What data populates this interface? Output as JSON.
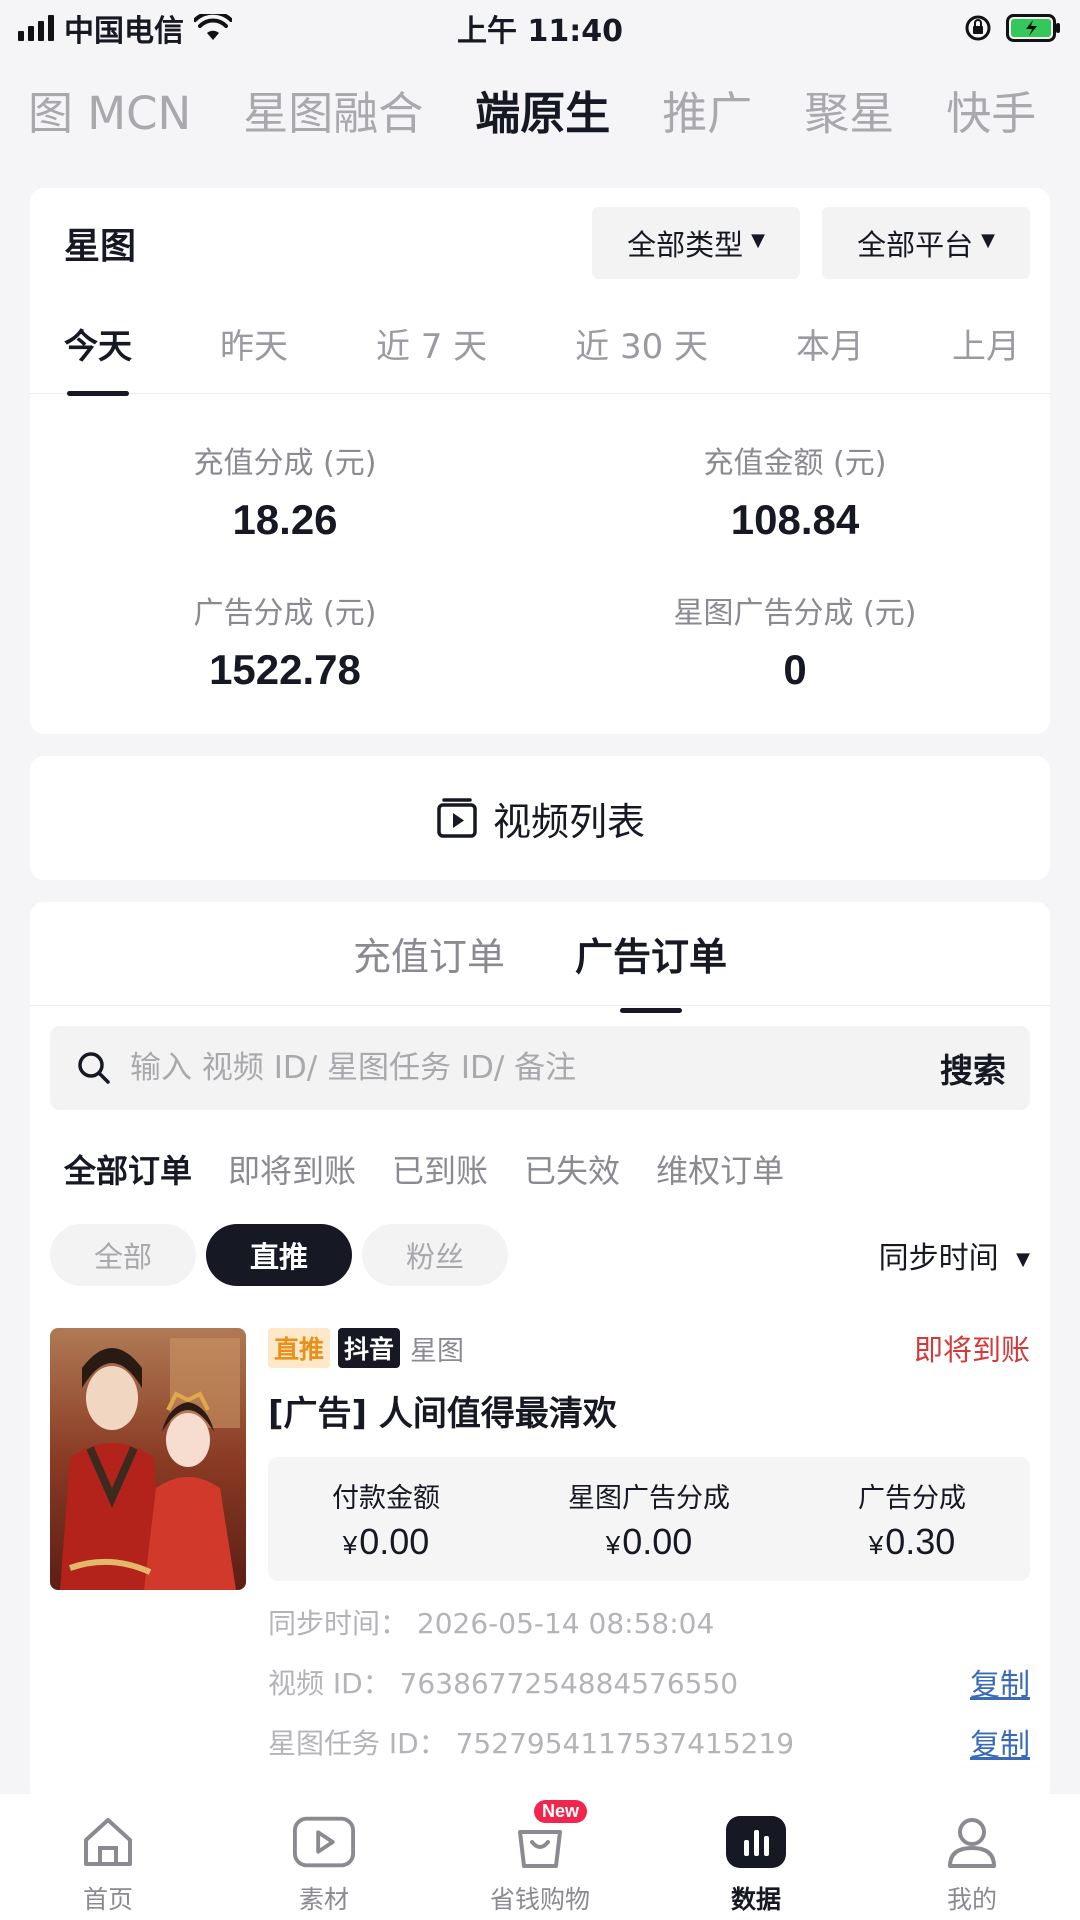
{
  "status_bar": {
    "carrier": "中国电信",
    "time": "上午 11:40"
  },
  "top_tabs": [
    {
      "label": "图 MCN",
      "active": false
    },
    {
      "label": "星图融合",
      "active": false
    },
    {
      "label": "端原生",
      "active": true
    },
    {
      "label": "推广",
      "active": false
    },
    {
      "label": "聚星",
      "active": false
    },
    {
      "label": "快手",
      "active": false
    }
  ],
  "stats_card": {
    "title": "星图",
    "filter_type": "全部类型",
    "filter_platform": "全部平台",
    "date_tabs": [
      {
        "label": "今天",
        "active": true
      },
      {
        "label": "昨天",
        "active": false
      },
      {
        "label": "近 7 天",
        "active": false
      },
      {
        "label": "近 30 天",
        "active": false
      },
      {
        "label": "本月",
        "active": false
      },
      {
        "label": "上月",
        "active": false
      }
    ],
    "stats": [
      {
        "label": "充值分成 (元)",
        "value": "18.26"
      },
      {
        "label": "充值金额 (元)",
        "value": "108.84"
      },
      {
        "label": "广告分成 (元)",
        "value": "1522.78"
      },
      {
        "label": "星图广告分成 (元)",
        "value": "0"
      }
    ]
  },
  "video_list": {
    "label": "视频列表",
    "icon": "video-list-icon"
  },
  "orders": {
    "type_tabs": [
      {
        "label": "充值订单",
        "active": false
      },
      {
        "label": "广告订单",
        "active": true
      }
    ],
    "search": {
      "placeholder": "输入 视频 ID/ 星图任务 ID/ 备注",
      "value": "",
      "button": "搜索"
    },
    "status_tabs": [
      {
        "label": "全部订单",
        "active": true
      },
      {
        "label": "即将到账",
        "active": false
      },
      {
        "label": "已到账",
        "active": false
      },
      {
        "label": "已失效",
        "active": false
      },
      {
        "label": "维权订单",
        "active": false
      }
    ],
    "chips": [
      {
        "label": "全部",
        "active": false
      },
      {
        "label": "直推",
        "active": true
      },
      {
        "label": "粉丝",
        "active": false
      }
    ],
    "sort_label": "同步时间",
    "items": [
      {
        "tag_direct": "直推",
        "tag_platform": "抖音",
        "tag_source": "星图",
        "status": "即将到账",
        "title": "[广告] 人间值得最清欢",
        "amounts": [
          {
            "label": "付款金额",
            "currency": "¥",
            "value": "0.00"
          },
          {
            "label": "星图广告分成",
            "currency": "¥",
            "value": "0.00"
          },
          {
            "label": "广告分成",
            "currency": "¥",
            "value": "0.30"
          }
        ],
        "sync_time": "同步时间： 2026-05-14 08:58:04",
        "video_id": "视频 ID： 7638677254884576550",
        "task_id": "星图任务 ID： 7527954117537415219",
        "copy_label": "复制"
      }
    ]
  },
  "bottom_nav": [
    {
      "label": "首页",
      "icon": "home-icon",
      "active": false
    },
    {
      "label": "素材",
      "icon": "play-icon",
      "active": false
    },
    {
      "label": "省钱购物",
      "icon": "shopping-bag-icon",
      "active": false,
      "badge": "New"
    },
    {
      "label": "数据",
      "icon": "bar-chart-icon",
      "active": true
    },
    {
      "label": "我的",
      "icon": "user-icon",
      "active": false
    }
  ],
  "colors": {
    "accent": "#161823",
    "pending_status": "#d43a3a",
    "link": "#3a6bb8",
    "tag_direct_bg": "#fde8c8",
    "tag_direct_text": "#e8901c",
    "badge": "#f0264f"
  }
}
